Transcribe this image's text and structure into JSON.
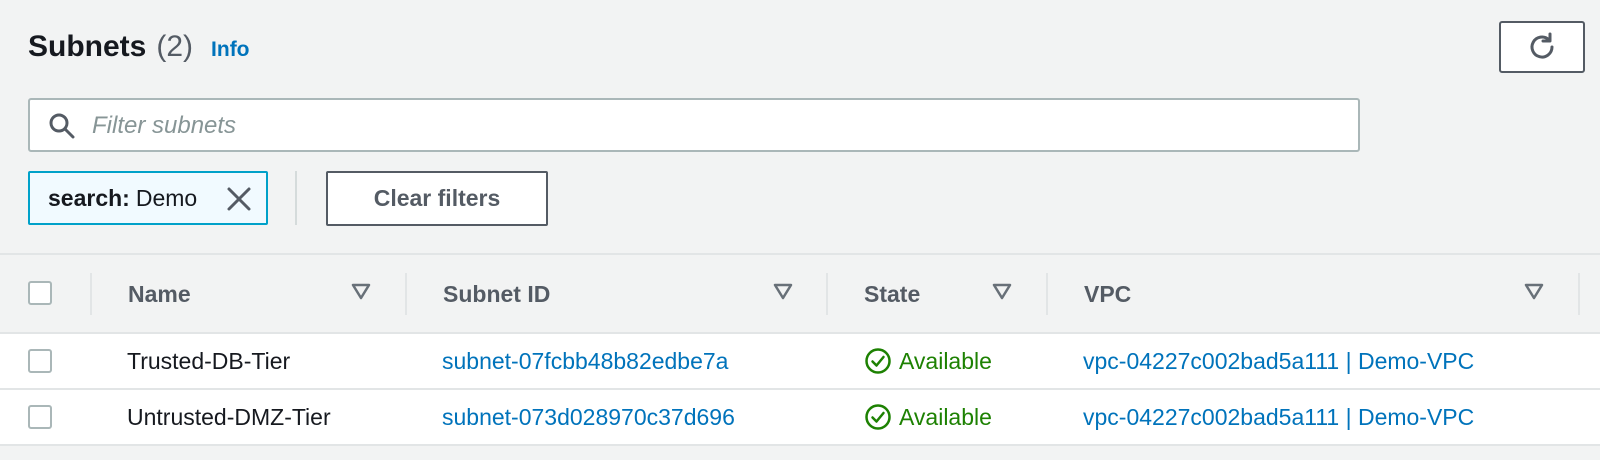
{
  "header": {
    "title": "Subnets",
    "count": "(2)",
    "info": "Info"
  },
  "search": {
    "placeholder": "Filter subnets",
    "value": ""
  },
  "filter_token": {
    "key": "search:",
    "value": "Demo"
  },
  "clear_filters_label": "Clear filters",
  "columns": [
    "Name",
    "Subnet ID",
    "State",
    "VPC"
  ],
  "rows": [
    {
      "name": "Trusted-DB-Tier",
      "subnet_id": "subnet-07fcbb48b82edbe7a",
      "state": "Available",
      "vpc": "vpc-04227c002bad5a111 | Demo-VPC"
    },
    {
      "name": "Untrusted-DMZ-Tier",
      "subnet_id": "subnet-073d028970c37d696",
      "state": "Available",
      "vpc": "vpc-04227c002bad5a111 | Demo-VPC"
    }
  ],
  "colors": {
    "link": "#0073bb",
    "status_ok": "#1d8102",
    "token_border": "#00a1c9"
  },
  "icons": [
    "refresh-icon",
    "search-icon",
    "close-icon",
    "sort-caret-icon",
    "status-available-icon"
  ]
}
